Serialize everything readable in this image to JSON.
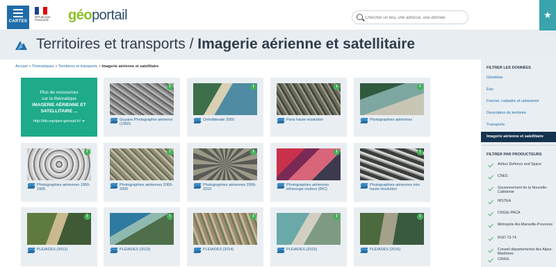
{
  "header": {
    "menu_label": "CARTES",
    "brand_text": "RÉPUBLIQUE FRANÇAISE",
    "logo_prefix": "géo",
    "logo_suffix": "portail",
    "search_placeholder": "Chercher un lieu, une adresse, une donnée",
    "search_icon": "search-icon",
    "favorites_icon": "star-icon",
    "flag_colors": [
      "#1f3f91",
      "#ffffff",
      "#e1000f"
    ]
  },
  "title": {
    "prefix": "Territoires et transports / ",
    "bold": "Imagerie aérienne et satellitaire"
  },
  "breadcrumb": {
    "items": [
      "Accueil",
      "Thématiques",
      "Territoires et transports"
    ],
    "separator": ">",
    "current": "Imagerie aérienne et satellitaire"
  },
  "promo": {
    "line1": "Plus de ressources",
    "line2": "sur la thématique",
    "line3": "IMAGERIE AÉRIENNE ET",
    "line4": "SATELLITAIRE ...",
    "url": "http://ids.equipex-geosud.fr/ ➔"
  },
  "cards": [
    {
      "label": "Guyane Photographie aérienne (1950)",
      "info": "i"
    },
    {
      "label": "Orthólittorale 2000",
      "info": "i"
    },
    {
      "label": "Paris haute résolution",
      "info": "i"
    },
    {
      "label": "Photographies aériennes",
      "info": "i"
    },
    {
      "label": "Photographies aériennes 1950-1965",
      "info": "i"
    },
    {
      "label": "Photographies aériennes 2000-2005",
      "info": "i"
    },
    {
      "label": "Photographies aériennes 2006-2010",
      "info": "i"
    },
    {
      "label": "Photographies aériennes infrarouge couleur (IRC)",
      "info": "i"
    },
    {
      "label": "Photographies aériennes très haute résolution",
      "info": "i"
    },
    {
      "label": "PLEIADES (2012)",
      "info": "i"
    },
    {
      "label": "PLEIADES (2013)",
      "info": "i"
    },
    {
      "label": "PLEIADES (2014)",
      "info": "i"
    },
    {
      "label": "PLEIADES (2015)",
      "info": "i"
    },
    {
      "label": "PLEIADES (2016)",
      "info": "i"
    }
  ],
  "sidebar": {
    "filter_title": "FILTRER LES DONNÉES",
    "filters": [
      {
        "label": "Géodésie",
        "active": false
      },
      {
        "label": "Eau",
        "active": false
      },
      {
        "label": "Foncier, cadastre et urbanisme",
        "active": false
      },
      {
        "label": "Description du territoire",
        "active": false
      },
      {
        "label": "Transports",
        "active": false
      },
      {
        "label": "Imagerie aérienne et satellitaire",
        "active": true
      }
    ],
    "producers_title": "FILTRER PAR PRODUCTEURS",
    "producers": [
      "Airbus Defence and Space",
      "CNES",
      "Gouvernement de la Nouvelle-Calédonie",
      "IRSTEA",
      "CRIGE-PACA",
      "Métropole Aix-Marseille-Provence",
      "RGD 73-74",
      "Conseil départemental des Alpes-Maritimes",
      "CRAIG"
    ]
  },
  "colors": {
    "accent_blue": "#1f6da8",
    "promo_green": "#1dab8a",
    "info_green": "#46b05a",
    "active_filter": "#15324f"
  }
}
